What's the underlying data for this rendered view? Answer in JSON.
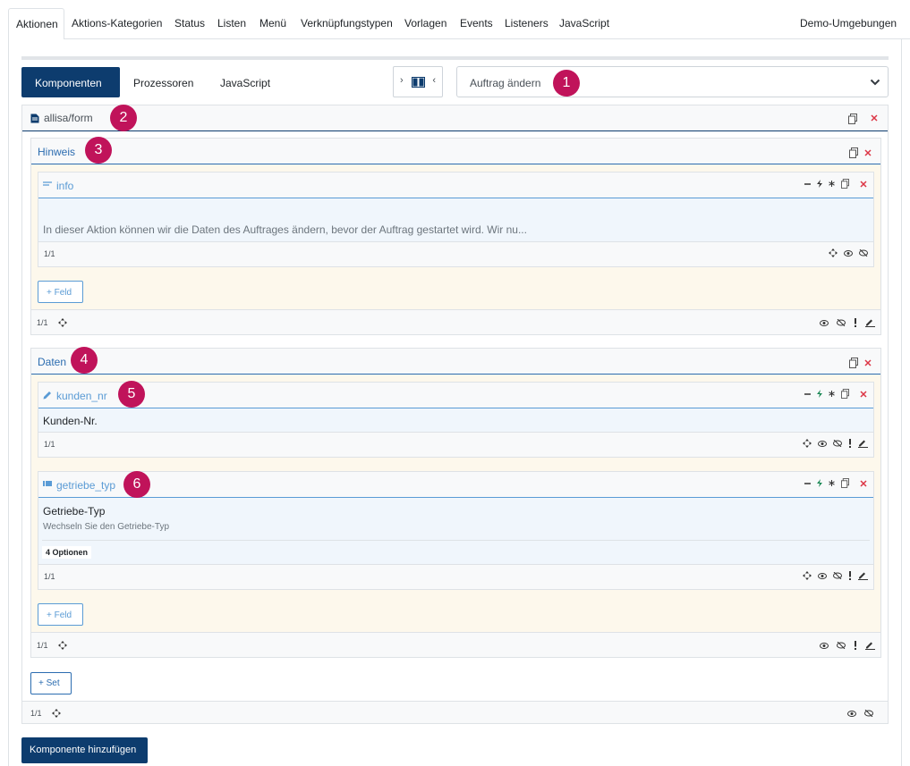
{
  "top_tabs": [
    {
      "label": "Aktionen",
      "active": true
    },
    {
      "label": "Aktions-Kategorien"
    },
    {
      "label": "Status"
    },
    {
      "label": "Listen"
    },
    {
      "label": "Menü"
    },
    {
      "label": "Verknüpfungstypen"
    },
    {
      "label": "Vorlagen"
    },
    {
      "label": "Events"
    },
    {
      "label": "Listeners"
    },
    {
      "label": "JavaScript"
    }
  ],
  "demo_link": "Demo-Umgebungen",
  "subtabs": {
    "active": "Komponenten",
    "prozessoren": "Prozessoren",
    "javascript": "JavaScript"
  },
  "toggle": {
    "left": "›",
    "right": "‹"
  },
  "action_select": {
    "value": "Auftrag ändern"
  },
  "badges": [
    "1",
    "2",
    "3",
    "4",
    "5",
    "6"
  ],
  "component": {
    "title": "allisa/form",
    "footer_counter": "1/1",
    "sets": [
      {
        "title": "Hinweis",
        "footer_counter": "1/1",
        "add_field_label": "+ Feld",
        "fields": [
          {
            "name": "info",
            "text": "In dieser Aktion können wir die Daten des Auftrages ändern, bevor der Auftrag gestartet wird. Wir nu...",
            "counter": "1/1"
          }
        ]
      },
      {
        "title": "Daten",
        "footer_counter": "1/1",
        "add_field_label": "+ Feld",
        "fields": [
          {
            "name": "kunden_nr",
            "label": "Kunden-Nr.",
            "counter": "1/1"
          },
          {
            "name": "getriebe_typ",
            "label": "Getriebe-Typ",
            "help": "Wechseln Sie den Getriebe-Typ",
            "options": "4 Optionen",
            "counter": "1/1"
          }
        ]
      }
    ],
    "add_set_label": "+ Set"
  },
  "add_component_label": "Komponente hinzufügen",
  "colors": {
    "primary": "#0d3c6e",
    "link": "#2b6cb0",
    "field_link": "#5a9bd5",
    "badge": "#c0135a",
    "danger": "#dc3545",
    "success": "#198754",
    "set_bg": "#fdf8ec",
    "field_bg": "#f0f6fc"
  },
  "icons": {
    "component": "document-icon",
    "info_field": "text-lines-icon",
    "kunden_field": "pencil-icon",
    "getriebe_field": "list-icon",
    "copy": "copy-icon",
    "close": "close-icon",
    "minus": "minus-icon",
    "bolt": "bolt-icon",
    "asterisk": "asterisk-icon",
    "move": "move-icon",
    "eye": "eye-icon",
    "eye_slash": "eye-slash-icon",
    "exclamation": "exclamation-icon",
    "edit": "edit-icon"
  }
}
